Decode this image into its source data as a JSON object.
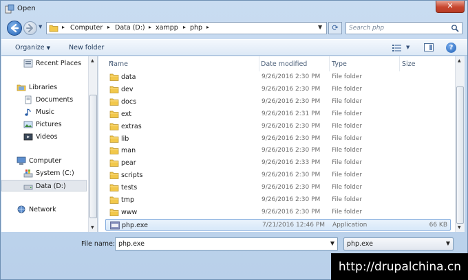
{
  "window": {
    "title": "Open",
    "close_label": "✕"
  },
  "address": {
    "crumbs": [
      "Computer",
      "Data (D:)",
      "xampp",
      "php"
    ]
  },
  "search": {
    "placeholder": "Search php"
  },
  "toolbar": {
    "organize_label": "Organize",
    "new_folder_label": "New folder"
  },
  "nav": {
    "items": [
      {
        "label": "Recent Places",
        "icon": "recent-places-icon"
      },
      {
        "label": "Libraries",
        "icon": "libraries-icon"
      },
      {
        "label": "Documents",
        "icon": "documents-icon"
      },
      {
        "label": "Music",
        "icon": "music-icon"
      },
      {
        "label": "Pictures",
        "icon": "pictures-icon"
      },
      {
        "label": "Videos",
        "icon": "videos-icon"
      },
      {
        "label": "Computer",
        "icon": "computer-icon"
      },
      {
        "label": "System (C:)",
        "icon": "drive-icon"
      },
      {
        "label": "Data (D:)",
        "icon": "drive-icon"
      },
      {
        "label": "Network",
        "icon": "network-icon"
      }
    ],
    "selected": "Data (D:)"
  },
  "columns": {
    "name": "Name",
    "date": "Date modified",
    "type": "Type",
    "size": "Size"
  },
  "files": [
    {
      "name": "data",
      "date": "9/26/2016 2:30 PM",
      "type": "File folder",
      "size": ""
    },
    {
      "name": "dev",
      "date": "9/26/2016 2:30 PM",
      "type": "File folder",
      "size": ""
    },
    {
      "name": "docs",
      "date": "9/26/2016 2:30 PM",
      "type": "File folder",
      "size": ""
    },
    {
      "name": "ext",
      "date": "9/26/2016 2:31 PM",
      "type": "File folder",
      "size": ""
    },
    {
      "name": "extras",
      "date": "9/26/2016 2:30 PM",
      "type": "File folder",
      "size": ""
    },
    {
      "name": "lib",
      "date": "9/26/2016 2:30 PM",
      "type": "File folder",
      "size": ""
    },
    {
      "name": "man",
      "date": "9/26/2016 2:30 PM",
      "type": "File folder",
      "size": ""
    },
    {
      "name": "pear",
      "date": "9/26/2016 2:33 PM",
      "type": "File folder",
      "size": ""
    },
    {
      "name": "scripts",
      "date": "9/26/2016 2:30 PM",
      "type": "File folder",
      "size": ""
    },
    {
      "name": "tests",
      "date": "9/26/2016 2:30 PM",
      "type": "File folder",
      "size": ""
    },
    {
      "name": "tmp",
      "date": "9/26/2016 2:30 PM",
      "type": "File folder",
      "size": ""
    },
    {
      "name": "www",
      "date": "9/26/2016 2:30 PM",
      "type": "File folder",
      "size": ""
    },
    {
      "name": "php.exe",
      "date": "7/21/2016 12:46 PM",
      "type": "Application",
      "size": "66 KB"
    }
  ],
  "selected_file": "php.exe",
  "file_name": {
    "label": "File name:",
    "value": "php.exe"
  },
  "file_type": {
    "value": "php.exe"
  },
  "watermark": "http://drupalchina.cn",
  "colors": {
    "selection": "#d7e8f9",
    "folder": "#f2c84b",
    "close": "#c7462e"
  }
}
